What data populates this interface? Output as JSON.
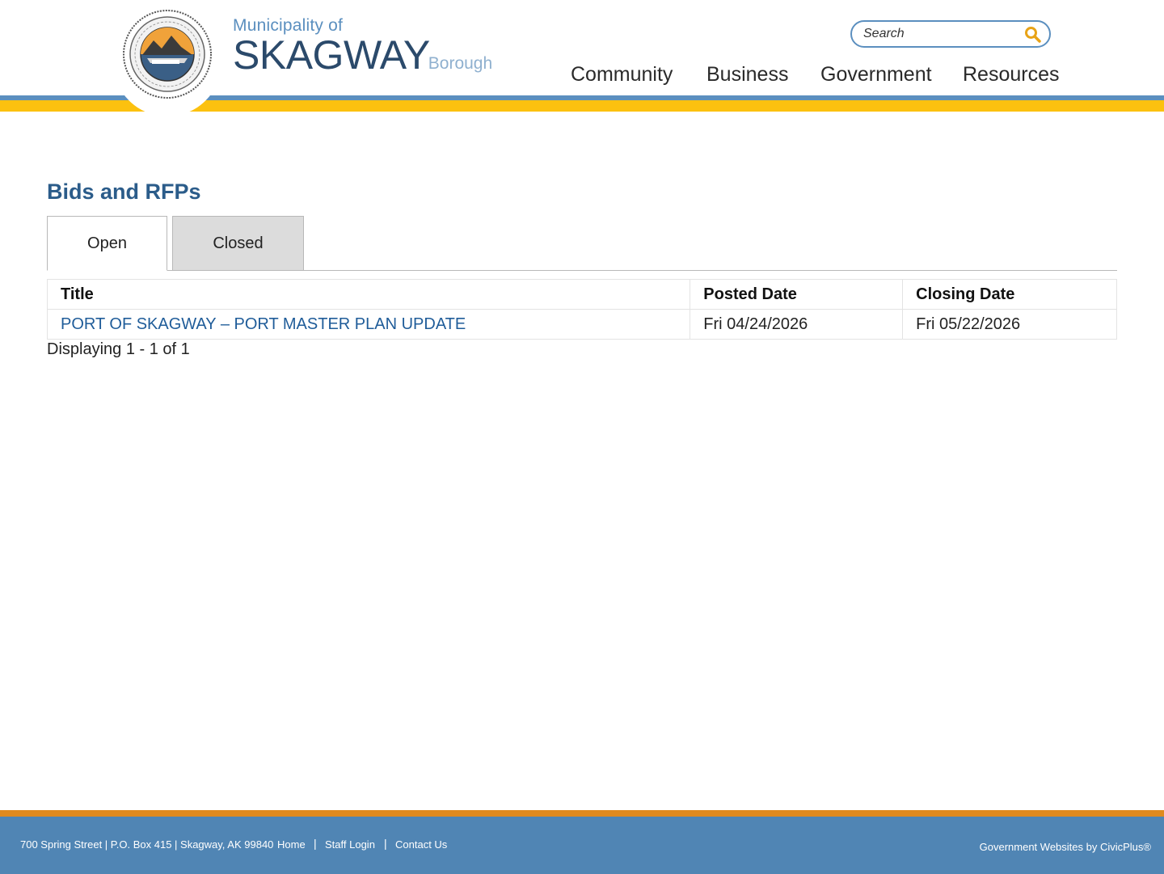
{
  "header": {
    "brand": {
      "municipality": "Municipality of",
      "name": "SKAGWAY",
      "suffix": "Borough"
    },
    "search": {
      "placeholder": "Search"
    },
    "nav": [
      {
        "label": "Community"
      },
      {
        "label": "Business"
      },
      {
        "label": "Government"
      },
      {
        "label": "Resources"
      }
    ]
  },
  "main": {
    "title": "Bids and RFPs",
    "tabs": [
      {
        "label": "Open",
        "active": true
      },
      {
        "label": "Closed",
        "active": false
      }
    ],
    "table": {
      "columns": [
        "Title",
        "Posted Date",
        "Closing Date"
      ],
      "rows": [
        {
          "title": "PORT OF SKAGWAY – PORT MASTER PLAN UPDATE",
          "posted": "Fri 04/24/2026",
          "closing": "Fri 05/22/2026"
        }
      ]
    },
    "displaying": "Displaying 1 - 1 of 1"
  },
  "footer": {
    "address": "700 Spring Street | P.O. Box 415 | Skagway, AK 99840",
    "links": [
      {
        "label": "Home"
      },
      {
        "label": "Staff Login"
      },
      {
        "label": "Contact Us"
      }
    ],
    "separator": "|",
    "credit": "Government Websites by CivicPlus®"
  },
  "colors": {
    "header_blue": "#5b8fbf",
    "header_gold": "#fcc10f",
    "title_blue": "#2b5c8a",
    "link_blue": "#1f5c99",
    "footer_orange": "#e08a1e",
    "footer_blue": "#5085b4"
  },
  "icons": {
    "search": "magnifier-icon",
    "seal": "municipal-seal-icon"
  }
}
